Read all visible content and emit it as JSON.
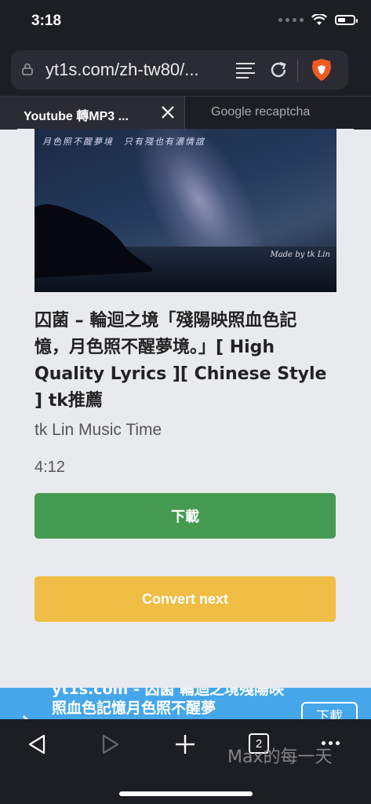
{
  "status": {
    "time": "3:18"
  },
  "browser": {
    "url": "yt1s.com/zh-tw80/...",
    "tabs": [
      {
        "title": "Youtube 轉MP3 ...",
        "active": true
      },
      {
        "title": "Google recaptcha",
        "active": false
      }
    ],
    "tab_count": "2"
  },
  "video": {
    "thumbnail_caption": "月色照不醒夢境　只有殘也有濃情誼",
    "thumbnail_credit": "Made by tk Lin",
    "title": "囚菌 – 輪迴之境「殘陽映照血色記憶，月色照不醒夢境。」[ High Quality Lyrics ][ Chinese Style ] tk推薦",
    "channel": "tk Lin Music Time",
    "duration": "4:12"
  },
  "buttons": {
    "download": "下載",
    "convert_next": "Convert next"
  },
  "banner": {
    "text": "yt1s.com - 囚菌  輪迴之境殘陽映照血色記憶月色照不醒夢",
    "button": "下載"
  },
  "watermark": "Max的每一天",
  "colors": {
    "download": "#459a52",
    "convert_next": "#f0bd45",
    "banner": "#45a6ea",
    "chrome": "#1d1e24"
  }
}
